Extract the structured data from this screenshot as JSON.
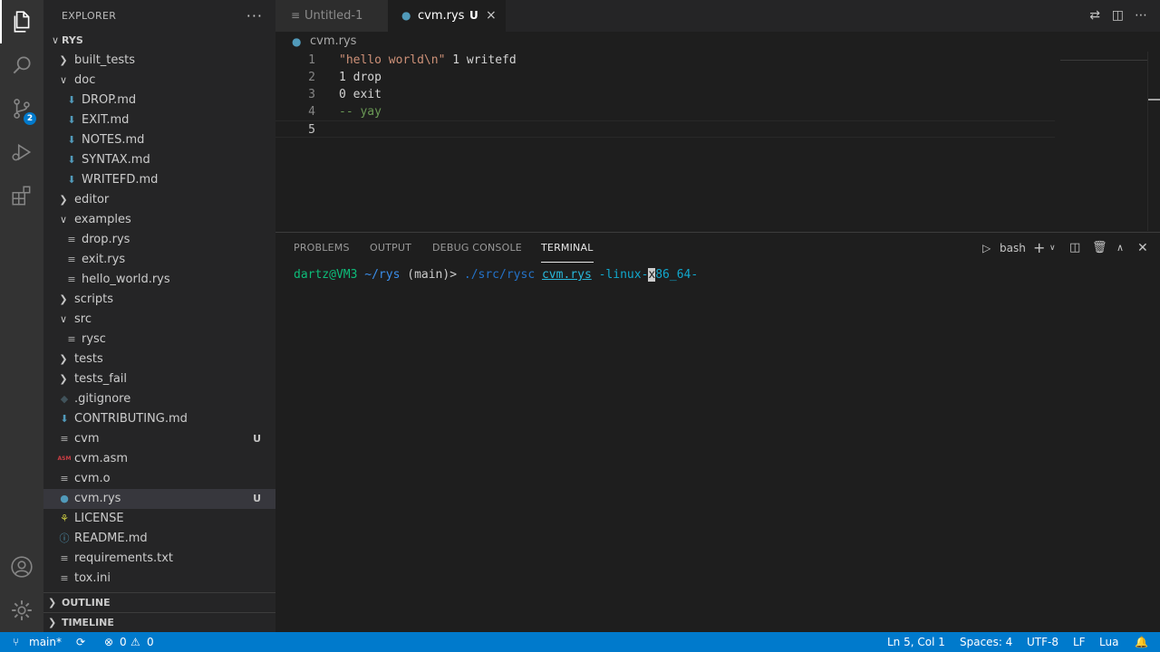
{
  "sidebar": {
    "title": "EXPLORER",
    "more": "···",
    "tree": [
      {
        "label": "RYS",
        "kind": "root",
        "chev": "open",
        "depth": 0,
        "icon": "none"
      },
      {
        "label": "built_tests",
        "kind": "folder",
        "chev": "closed",
        "depth": 1,
        "icon": "none"
      },
      {
        "label": "doc",
        "kind": "folder",
        "chev": "open",
        "depth": 1,
        "icon": "none"
      },
      {
        "label": "DROP.md",
        "kind": "file",
        "depth": 2,
        "icon": "markdown"
      },
      {
        "label": "EXIT.md",
        "kind": "file",
        "depth": 2,
        "icon": "markdown"
      },
      {
        "label": "NOTES.md",
        "kind": "file",
        "depth": 2,
        "icon": "markdown"
      },
      {
        "label": "SYNTAX.md",
        "kind": "file",
        "depth": 2,
        "icon": "markdown"
      },
      {
        "label": "WRITEFD.md",
        "kind": "file",
        "depth": 2,
        "icon": "markdown"
      },
      {
        "label": "editor",
        "kind": "folder",
        "chev": "closed",
        "depth": 1,
        "icon": "none"
      },
      {
        "label": "examples",
        "kind": "folder",
        "chev": "open",
        "depth": 1,
        "icon": "none"
      },
      {
        "label": "drop.rys",
        "kind": "file",
        "depth": 2,
        "icon": "text"
      },
      {
        "label": "exit.rys",
        "kind": "file",
        "depth": 2,
        "icon": "text"
      },
      {
        "label": "hello_world.rys",
        "kind": "file",
        "depth": 2,
        "icon": "text"
      },
      {
        "label": "scripts",
        "kind": "folder",
        "chev": "closed",
        "depth": 1,
        "icon": "none"
      },
      {
        "label": "src",
        "kind": "folder",
        "chev": "open",
        "depth": 1,
        "icon": "none"
      },
      {
        "label": "rysc",
        "kind": "file",
        "depth": 2,
        "icon": "text"
      },
      {
        "label": "tests",
        "kind": "folder",
        "chev": "closed",
        "depth": 1,
        "icon": "none"
      },
      {
        "label": "tests_fail",
        "kind": "folder",
        "chev": "closed",
        "depth": 1,
        "icon": "none"
      },
      {
        "label": ".gitignore",
        "kind": "file",
        "depth": 1,
        "icon": "git"
      },
      {
        "label": "CONTRIBUTING.md",
        "kind": "file",
        "depth": 1,
        "icon": "markdown"
      },
      {
        "label": "cvm",
        "kind": "file",
        "depth": 1,
        "icon": "text",
        "badge": "U"
      },
      {
        "label": "cvm.asm",
        "kind": "file",
        "depth": 1,
        "icon": "asm"
      },
      {
        "label": "cvm.o",
        "kind": "file",
        "depth": 1,
        "icon": "text"
      },
      {
        "label": "cvm.rys",
        "kind": "file",
        "depth": 1,
        "icon": "lua",
        "badge": "U",
        "selected": true
      },
      {
        "label": "LICENSE",
        "kind": "file",
        "depth": 1,
        "icon": "license"
      },
      {
        "label": "README.md",
        "kind": "file",
        "depth": 1,
        "icon": "info"
      },
      {
        "label": "requirements.txt",
        "kind": "file",
        "depth": 1,
        "icon": "text"
      },
      {
        "label": "tox.ini",
        "kind": "file",
        "depth": 1,
        "icon": "text"
      }
    ],
    "sections": [
      "OUTLINE",
      "TIMELINE"
    ]
  },
  "activity": {
    "scm_badge": "2"
  },
  "tabs": [
    {
      "label": "Untitled-1",
      "active": false,
      "icon": "text"
    },
    {
      "label": "cvm.rys",
      "active": true,
      "icon": "lua",
      "badge": "U",
      "close": "×"
    }
  ],
  "breadcrumb": {
    "file": "cvm.rys"
  },
  "editor": {
    "lines": [
      {
        "num": "1",
        "parts": [
          {
            "t": "\"hello world\\n\"",
            "c": "str"
          },
          {
            "t": " 1 writefd",
            "c": ""
          }
        ]
      },
      {
        "num": "2",
        "parts": [
          {
            "t": "1 drop",
            "c": ""
          }
        ]
      },
      {
        "num": "3",
        "parts": [
          {
            "t": "0 exit",
            "c": ""
          }
        ]
      },
      {
        "num": "4",
        "parts": [
          {
            "t": "-- yay",
            "c": "cmt"
          }
        ]
      },
      {
        "num": "5",
        "parts": [],
        "current": true
      }
    ]
  },
  "panel": {
    "tabs": [
      "PROBLEMS",
      "OUTPUT",
      "DEBUG CONSOLE",
      "TERMINAL"
    ],
    "active_tab": "TERMINAL",
    "shell": "bash",
    "terminal": {
      "user_host": "dartz@VM3",
      "path": "~/rys",
      "branch": "(main)>",
      "command": "./src/rysc",
      "arg_file": "cvm.rys",
      "arg_pre": "-linux-",
      "cursor_char": "x",
      "arg_post": "86_64-"
    }
  },
  "status": {
    "branch": "main*",
    "errors": "0",
    "warnings": "0",
    "position": "Ln 5, Col 1",
    "spaces": "Spaces: 4",
    "encoding": "UTF-8",
    "eol": "LF",
    "language": "Lua"
  }
}
